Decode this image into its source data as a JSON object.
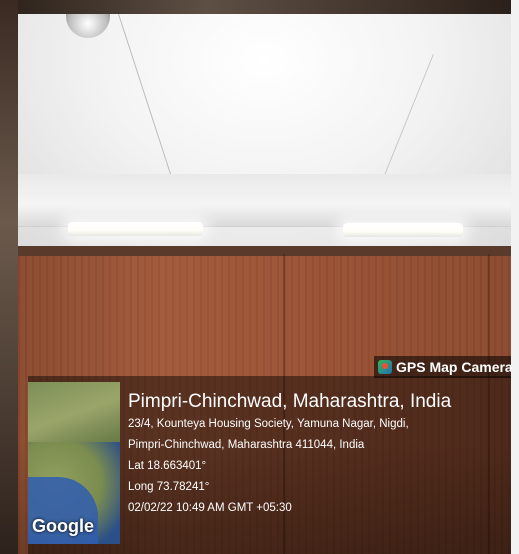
{
  "watermark": {
    "badge_label": "GPS Map Camera",
    "place": "Pimpri-Chinchwad, Maharashtra, India",
    "address_line1": "23/4, Kounteya Housing Society, Yamuna Nagar, Nigdi,",
    "address_line2": "Pimpri-Chinchwad, Maharashtra 411044, India",
    "latitude": "Lat 18.663401°",
    "longitude": "Long 73.78241°",
    "datetime": "02/02/22 10:49 AM GMT +05:30",
    "map_provider": "Google"
  },
  "icons": {
    "camera_badge": "gps-map-camera-icon"
  }
}
